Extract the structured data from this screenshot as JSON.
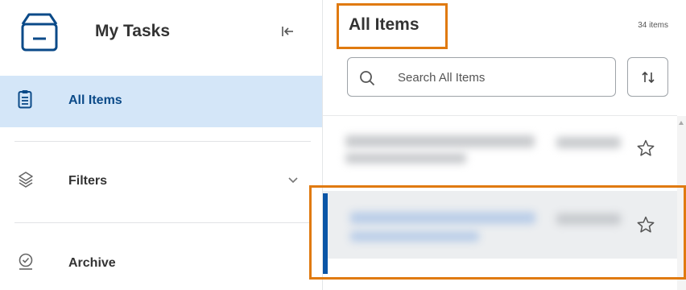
{
  "sidebar": {
    "title": "My Tasks",
    "nav": {
      "all_items": "All Items",
      "filters": "Filters",
      "archive": "Archive"
    }
  },
  "main": {
    "title": "All Items",
    "count": "34 items",
    "search": {
      "placeholder": "Search All Items",
      "value": ""
    }
  },
  "colors": {
    "accent": "#0b4a88",
    "nav_selected_bg": "#d4e6f8",
    "selection_bar": "#0a55a6",
    "highlight_border": "#e07a10"
  },
  "icons": {
    "header": "inbox-tray-icon",
    "collapse": "collapse-left-icon",
    "all_items": "clipboard-list-icon",
    "filters": "layers-icon",
    "archive": "archive-check-icon",
    "search": "search-icon",
    "sort": "sort-arrows-icon",
    "favorite": "star-outline-icon",
    "expand": "chevron-down-icon"
  }
}
